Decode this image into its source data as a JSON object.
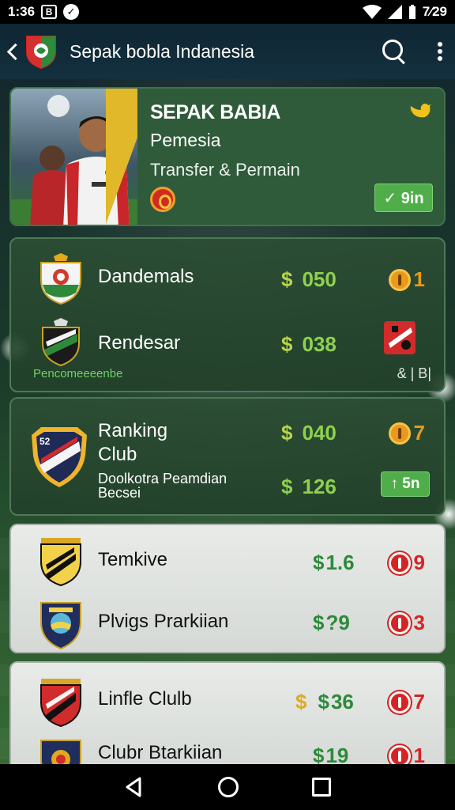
{
  "status_bar": {
    "time": "1:36",
    "battery": "7⁄29"
  },
  "app_bar": {
    "title": "Sepak bobla Indanesia",
    "logo_icon": "club-crest-icon",
    "search_icon": "search-icon",
    "menu_icon": "more-vert-icon"
  },
  "hero": {
    "title": "SEPAK BABIA",
    "subtitle": "Pemesia",
    "caption": "Transfer & Permain",
    "button_label": "✓ 9in",
    "icon": "twitter-bird-icon"
  },
  "list1": {
    "rows": [
      {
        "name": "Dandemals",
        "price": "050",
        "badge": "1"
      },
      {
        "name": "Rendesar",
        "price": "038"
      }
    ],
    "footer_note": "Pencomeeeenbe",
    "footer_meta": "& | B|"
  },
  "list2": {
    "title": "Ranking Club",
    "subtitle": "Doolkotra Peamdian Becsei",
    "price_1": "040",
    "badge_1": "7",
    "price_2": "126",
    "button_label": "↑ 5n"
  },
  "list3": {
    "rows": [
      {
        "name": "Temkive",
        "price": "1.6",
        "badge": "9"
      },
      {
        "name": "Plvigs Prarkiian",
        "price": "?9",
        "badge": "3"
      }
    ]
  },
  "list4": {
    "rows": [
      {
        "name": "Linfle Clulb",
        "price": "36",
        "badge": "7"
      },
      {
        "name": "Clubr Btarkiian",
        "price": "19",
        "badge": "1"
      }
    ]
  },
  "colors": {
    "card_green": "#2c4e34",
    "accent_green": "#4fae4a",
    "price_green": "#8fd14f",
    "badge_orange": "#e79a1c",
    "badge_red": "#d42424"
  }
}
